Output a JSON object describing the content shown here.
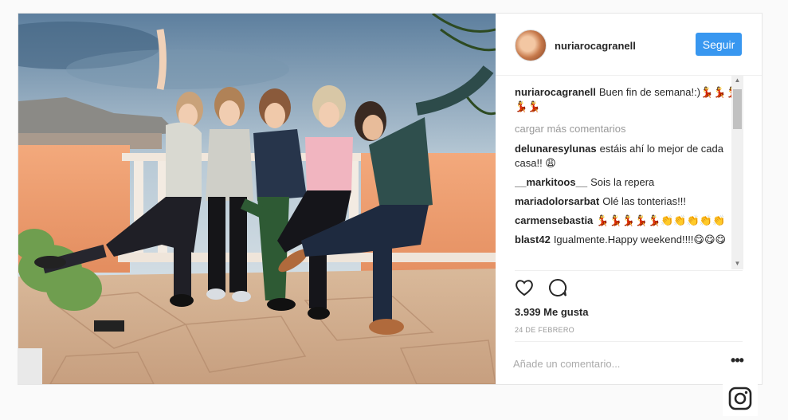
{
  "post": {
    "username": "nuriarocagranell",
    "follow_label": "Seguir",
    "caption": {
      "user": "nuriarocagranell",
      "text": "Buen fin de semana!:)💃💃💃💃💃"
    },
    "load_more_label": "cargar más comentarios",
    "comments": [
      {
        "user": "delunaresylunas",
        "text": "estáis ahí lo mejor de cada casa!! 😩"
      },
      {
        "user": "__markitoos__",
        "text": "Sois la repera"
      },
      {
        "user": "mariadolorsarbat",
        "text": "Olé las tonterias!!!"
      },
      {
        "user": "carmensebastia",
        "text": "💃💃💃💃💃👏👏👏👏👏"
      },
      {
        "user": "blast42",
        "text": "Igualmente.Happy weekend!!!!😋😋😋"
      }
    ],
    "likes_label": "3.939 Me gusta",
    "date_label": "24 DE FEBRERO",
    "comment_placeholder": "Añade un comentario...",
    "more_label": "•••"
  },
  "icons": {
    "like": "heart-icon",
    "comment": "speech-bubble-icon",
    "more": "more-options-icon",
    "brand": "instagram-icon"
  },
  "colors": {
    "accent": "#3897f0",
    "text": "#262626",
    "muted": "#999999"
  }
}
